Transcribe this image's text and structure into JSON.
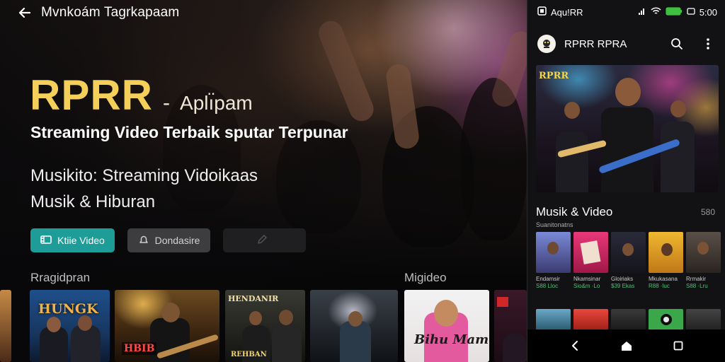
{
  "header": {
    "title": "Mvnkoám Tagrkapaam"
  },
  "hero": {
    "brand": "RPRR",
    "brand_dash": "-",
    "brand_sub": "Aplı̈pam",
    "tagline": "Streaming Video Terbaik sputar Terpunar",
    "desc_line1": "Musikito: Streaming Vidoikaas",
    "desc_line2": "Musik & Hiburan"
  },
  "actions": {
    "primary_label": "Ktiie Video",
    "secondary_label": "Dondasire",
    "tertiary_label": ""
  },
  "rows": {
    "left_label": "Rragidpran",
    "right_label": "Migideo"
  },
  "thumbnails": [
    {
      "caption": "HUNGK"
    },
    {
      "caption": "HBIB"
    },
    {
      "caption": "HENDANIR",
      "caption2": "REHBAN"
    },
    {
      "caption": ""
    },
    {
      "caption": "Bihu Mam"
    },
    {
      "caption": ""
    }
  ],
  "phone": {
    "status": {
      "app_name": "Aqu!RR",
      "right_text": "5:00"
    },
    "app_title": "RPRR RPRA",
    "featured_badge": "RPRR",
    "section_title": "Musik & Video",
    "section_count": "580",
    "section_subtitle": "Suanitonatns",
    "mini_items": [
      {
        "line1": "Endamsir",
        "line2": "S88 Lloc"
      },
      {
        "line1": "Nkamsinar",
        "line2": "Sio&m ·Lo"
      },
      {
        "line1": "Gloiriaks",
        "line2": "$39 Ekas"
      },
      {
        "line1": "Mkukasana",
        "line2": "R88 ·luc"
      },
      {
        "line1": "Rrmakir",
        "line2": "S88 ·Lru"
      }
    ]
  },
  "colors": {
    "accent": "#1e9c98",
    "brand_gold": "#f4cf5a",
    "battery": "#3fbf3f"
  },
  "icons": [
    "arrow-left-icon",
    "video-icon",
    "bell-icon",
    "pencil-icon",
    "search-icon",
    "more-vert-icon",
    "back-nav-icon",
    "home-icon",
    "recents-icon",
    "wifi-icon",
    "battery-icon"
  ]
}
